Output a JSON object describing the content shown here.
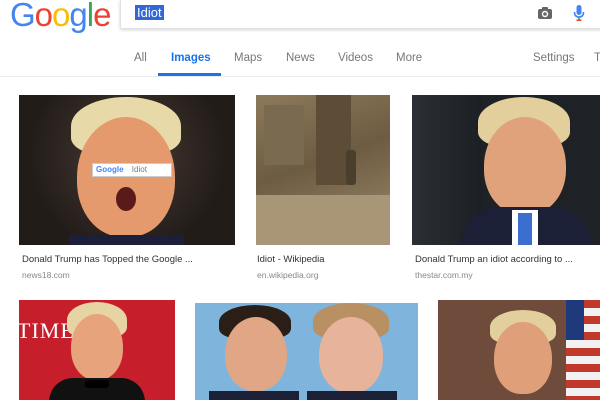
{
  "logo": {
    "letters": [
      "G",
      "o",
      "o",
      "g",
      "l",
      "e"
    ],
    "colors": [
      "#4285f4",
      "#ea4335",
      "#fbbc05",
      "#4285f4",
      "#34a853",
      "#ea4335"
    ]
  },
  "search": {
    "query": "Idiot"
  },
  "icons": {
    "camera": "camera-icon",
    "mic": "microphone-icon"
  },
  "tabs": [
    {
      "label": "All",
      "active": false
    },
    {
      "label": "Images",
      "active": true
    },
    {
      "label": "Maps",
      "active": false
    },
    {
      "label": "News",
      "active": false
    },
    {
      "label": "Videos",
      "active": false
    },
    {
      "label": "More",
      "active": false
    },
    {
      "label": "Settings",
      "active": false
    },
    {
      "label": "T",
      "active": false
    }
  ],
  "results": [
    {
      "caption": "Donald Trump has Topped the Google ...",
      "source": "news18.com",
      "overlay_brand": "Google",
      "overlay_text": "Idiot"
    },
    {
      "caption": "Idiot - Wikipedia",
      "source": "en.wikipedia.org"
    },
    {
      "caption": "Donald Trump an idiot according to ...",
      "source": "thestar.com.my"
    },
    {
      "overlay_text": "TIME"
    },
    {},
    {}
  ],
  "colors": {
    "accent": "#1a73e8",
    "query_highlight": "#3367d6"
  }
}
